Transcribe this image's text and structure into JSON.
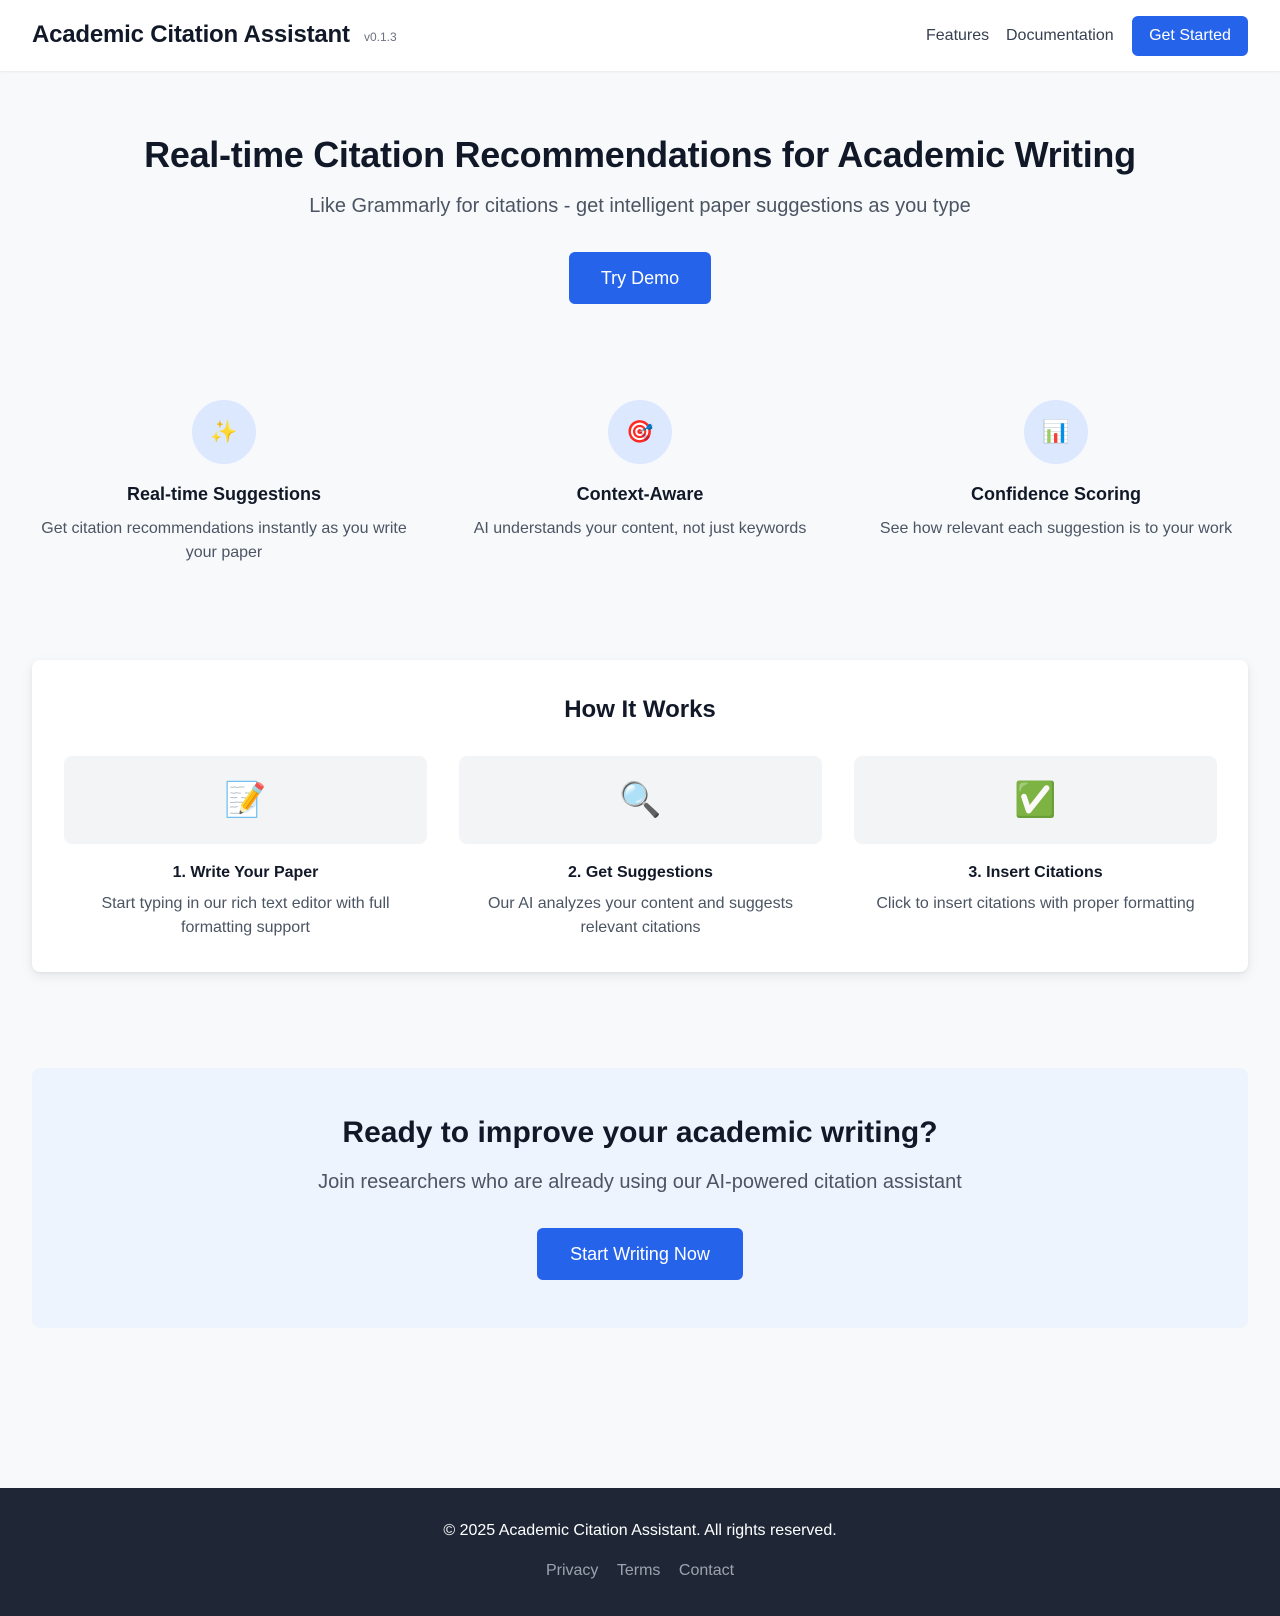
{
  "header": {
    "brand": "Academic Citation Assistant",
    "version": "v0.1.3",
    "nav": {
      "features": "Features",
      "documentation": "Documentation"
    },
    "cta_label": "Get Started"
  },
  "hero": {
    "title": "Real-time Citation Recommendations for Academic Writing",
    "subtitle": "Like Grammarly for citations - get intelligent paper suggestions as you type",
    "button_label": "Try Demo"
  },
  "features": [
    {
      "icon": "✨",
      "icon_name": "sparkles-icon",
      "title": "Real-time Suggestions",
      "description": "Get citation recommendations instantly as you write your paper"
    },
    {
      "icon": "🎯",
      "icon_name": "target-icon",
      "title": "Context-Aware",
      "description": "AI understands your content, not just keywords"
    },
    {
      "icon": "📊",
      "icon_name": "bar-chart-icon",
      "title": "Confidence Scoring",
      "description": "See how relevant each suggestion is to your work"
    }
  ],
  "how_it_works": {
    "title": "How It Works",
    "steps": [
      {
        "icon": "📝",
        "icon_name": "memo-icon",
        "title": "1. Write Your Paper",
        "description": "Start typing in our rich text editor with full formatting support"
      },
      {
        "icon": "🔍",
        "icon_name": "magnifier-icon",
        "title": "2. Get Suggestions",
        "description": "Our AI analyzes your content and suggests relevant citations"
      },
      {
        "icon": "✅",
        "icon_name": "check-mark-icon",
        "title": "3. Insert Citations",
        "description": "Click to insert citations with proper formatting"
      }
    ]
  },
  "cta": {
    "title": "Ready to improve your academic writing?",
    "subtitle": "Join researchers who are already using our AI-powered citation assistant",
    "button_label": "Start Writing Now"
  },
  "footer": {
    "copyright": "© 2025 Academic Citation Assistant. All rights reserved.",
    "links": {
      "privacy": "Privacy",
      "terms": "Terms",
      "contact": "Contact"
    }
  },
  "colors": {
    "accent": "#2563eb",
    "background": "#f8f9fb",
    "footer_bg": "#1f2737",
    "cta_bg": "#eef4fe",
    "feature_icon_bg": "#dbe8fe"
  }
}
